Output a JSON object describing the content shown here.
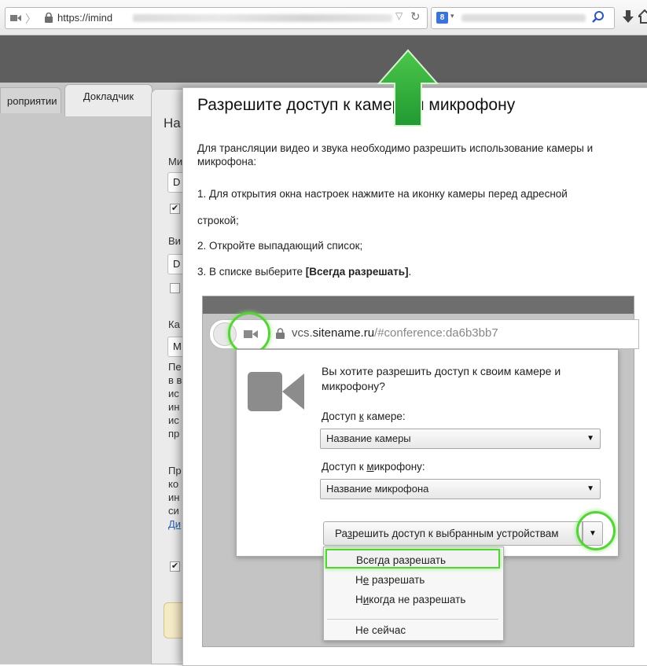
{
  "browser": {
    "url_visible": "https://imind",
    "search_engine_badge": "8",
    "icons": {
      "camera": "camera-icon",
      "lock": "lock-icon",
      "reload": "reload-icon",
      "search": "magnifier-icon",
      "download": "download-icon",
      "home": "home-icon"
    }
  },
  "page": {
    "tabs": [
      {
        "label": "роприятии"
      },
      {
        "label": "Докладчик"
      }
    ],
    "partial_heading": "На",
    "partial_letters": {
      "mi": "Ми",
      "d1": "D",
      "vi": "Ви",
      "d2": "D",
      "ka": "Ка",
      "m": "М",
      "pe": "Пе",
      "vv": "в в",
      "is1": "ис",
      "in1": "ин",
      "is2": "ис",
      "pr1": "пр",
      "pr2": "Пр",
      "ko": "ко",
      "in2": "ин",
      "si": "си",
      "di": "Ди"
    }
  },
  "dialog": {
    "title": "Разрешите доступ к камере и микрофону",
    "intro": "Для трансляции видео и звука необходимо разрешить использование камеры и микрофона:",
    "step1": "1. Для открытия окна настроек нажмите на иконку камеры перед адресной",
    "step1b": "строкой;",
    "step2": "2. Откройте выпадающий список;",
    "step3_prefix": "3. В списке выберите ",
    "step3_bold": "[Всегда разрешать]",
    "step3_suffix": "."
  },
  "example": {
    "url_host_prefix": "vcs.",
    "url_host": "sitename.ru",
    "url_path": "/#conference:da6b3bb7",
    "question": "Вы хотите разрешить доступ к своим камере и микрофону?",
    "camera_label_pre": "Доступ ",
    "camera_label_u": "к",
    "camera_label_post": " камере:",
    "camera_select": "Название камеры",
    "mic_label_pre": "Доступ к ",
    "mic_label_u": "м",
    "mic_label_post": "икрофону:",
    "mic_select": "Название микрофона",
    "allow_button_pre": "Ра",
    "allow_button_u": "з",
    "allow_button_post": "решить доступ к выбранным устройствам",
    "menu": [
      {
        "pre": "Всег",
        "u": "д",
        "post": "а разрешать"
      },
      {
        "pre": "Н",
        "u": "е",
        "post": " разрешать"
      },
      {
        "pre": "Н",
        "u": "и",
        "post": "когда не разрешать"
      },
      {
        "pre": "",
        "u": "",
        "post": "Не сейчас"
      }
    ]
  },
  "colors": {
    "highlight_green": "#58d23c",
    "arrow_green": "#2fa33a",
    "dark_band": "#5e5e5e"
  }
}
